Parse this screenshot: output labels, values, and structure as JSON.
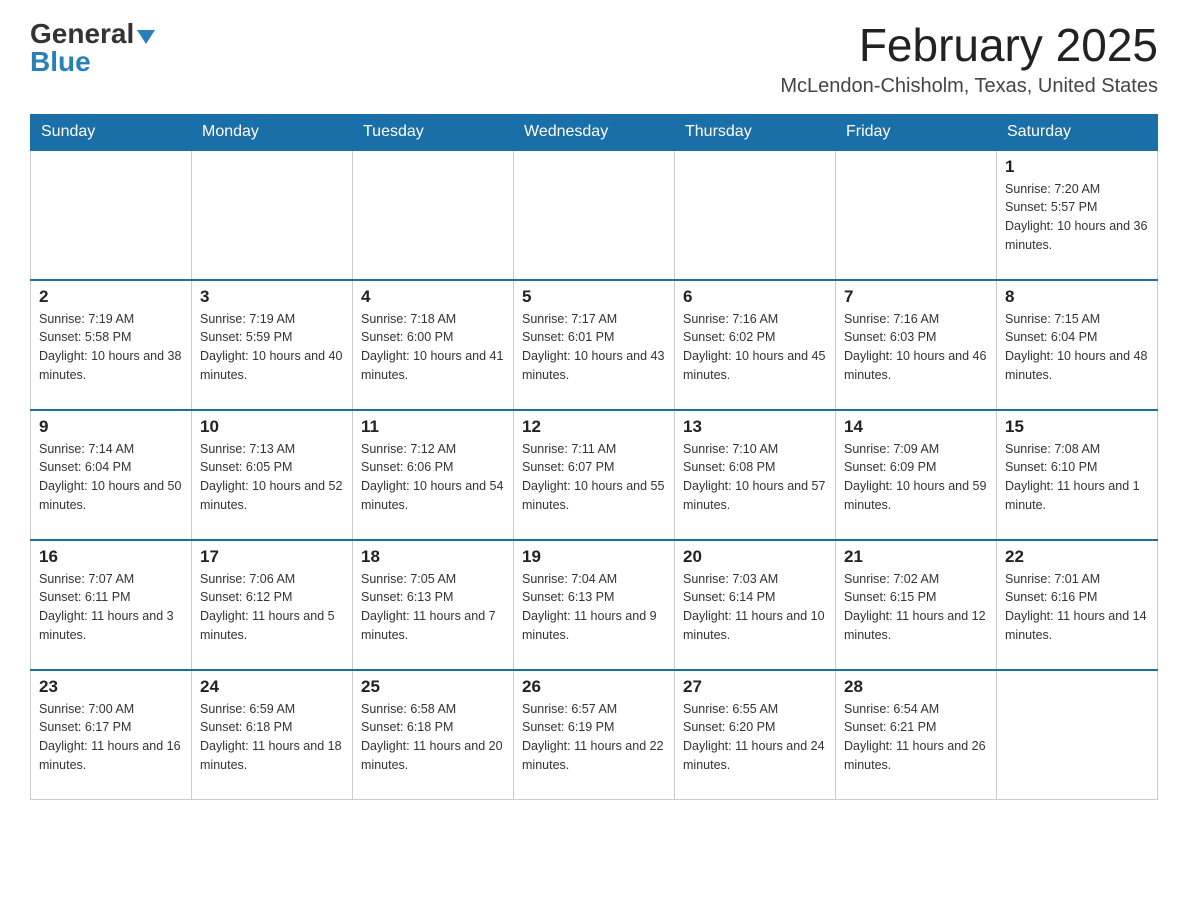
{
  "header": {
    "logo_general": "General",
    "logo_blue": "Blue",
    "month_title": "February 2025",
    "location": "McLendon-Chisholm, Texas, United States"
  },
  "weekdays": [
    "Sunday",
    "Monday",
    "Tuesday",
    "Wednesday",
    "Thursday",
    "Friday",
    "Saturday"
  ],
  "weeks": [
    [
      {
        "day": "",
        "sunrise": "",
        "sunset": "",
        "daylight": ""
      },
      {
        "day": "",
        "sunrise": "",
        "sunset": "",
        "daylight": ""
      },
      {
        "day": "",
        "sunrise": "",
        "sunset": "",
        "daylight": ""
      },
      {
        "day": "",
        "sunrise": "",
        "sunset": "",
        "daylight": ""
      },
      {
        "day": "",
        "sunrise": "",
        "sunset": "",
        "daylight": ""
      },
      {
        "day": "",
        "sunrise": "",
        "sunset": "",
        "daylight": ""
      },
      {
        "day": "1",
        "sunrise": "Sunrise: 7:20 AM",
        "sunset": "Sunset: 5:57 PM",
        "daylight": "Daylight: 10 hours and 36 minutes."
      }
    ],
    [
      {
        "day": "2",
        "sunrise": "Sunrise: 7:19 AM",
        "sunset": "Sunset: 5:58 PM",
        "daylight": "Daylight: 10 hours and 38 minutes."
      },
      {
        "day": "3",
        "sunrise": "Sunrise: 7:19 AM",
        "sunset": "Sunset: 5:59 PM",
        "daylight": "Daylight: 10 hours and 40 minutes."
      },
      {
        "day": "4",
        "sunrise": "Sunrise: 7:18 AM",
        "sunset": "Sunset: 6:00 PM",
        "daylight": "Daylight: 10 hours and 41 minutes."
      },
      {
        "day": "5",
        "sunrise": "Sunrise: 7:17 AM",
        "sunset": "Sunset: 6:01 PM",
        "daylight": "Daylight: 10 hours and 43 minutes."
      },
      {
        "day": "6",
        "sunrise": "Sunrise: 7:16 AM",
        "sunset": "Sunset: 6:02 PM",
        "daylight": "Daylight: 10 hours and 45 minutes."
      },
      {
        "day": "7",
        "sunrise": "Sunrise: 7:16 AM",
        "sunset": "Sunset: 6:03 PM",
        "daylight": "Daylight: 10 hours and 46 minutes."
      },
      {
        "day": "8",
        "sunrise": "Sunrise: 7:15 AM",
        "sunset": "Sunset: 6:04 PM",
        "daylight": "Daylight: 10 hours and 48 minutes."
      }
    ],
    [
      {
        "day": "9",
        "sunrise": "Sunrise: 7:14 AM",
        "sunset": "Sunset: 6:04 PM",
        "daylight": "Daylight: 10 hours and 50 minutes."
      },
      {
        "day": "10",
        "sunrise": "Sunrise: 7:13 AM",
        "sunset": "Sunset: 6:05 PM",
        "daylight": "Daylight: 10 hours and 52 minutes."
      },
      {
        "day": "11",
        "sunrise": "Sunrise: 7:12 AM",
        "sunset": "Sunset: 6:06 PM",
        "daylight": "Daylight: 10 hours and 54 minutes."
      },
      {
        "day": "12",
        "sunrise": "Sunrise: 7:11 AM",
        "sunset": "Sunset: 6:07 PM",
        "daylight": "Daylight: 10 hours and 55 minutes."
      },
      {
        "day": "13",
        "sunrise": "Sunrise: 7:10 AM",
        "sunset": "Sunset: 6:08 PM",
        "daylight": "Daylight: 10 hours and 57 minutes."
      },
      {
        "day": "14",
        "sunrise": "Sunrise: 7:09 AM",
        "sunset": "Sunset: 6:09 PM",
        "daylight": "Daylight: 10 hours and 59 minutes."
      },
      {
        "day": "15",
        "sunrise": "Sunrise: 7:08 AM",
        "sunset": "Sunset: 6:10 PM",
        "daylight": "Daylight: 11 hours and 1 minute."
      }
    ],
    [
      {
        "day": "16",
        "sunrise": "Sunrise: 7:07 AM",
        "sunset": "Sunset: 6:11 PM",
        "daylight": "Daylight: 11 hours and 3 minutes."
      },
      {
        "day": "17",
        "sunrise": "Sunrise: 7:06 AM",
        "sunset": "Sunset: 6:12 PM",
        "daylight": "Daylight: 11 hours and 5 minutes."
      },
      {
        "day": "18",
        "sunrise": "Sunrise: 7:05 AM",
        "sunset": "Sunset: 6:13 PM",
        "daylight": "Daylight: 11 hours and 7 minutes."
      },
      {
        "day": "19",
        "sunrise": "Sunrise: 7:04 AM",
        "sunset": "Sunset: 6:13 PM",
        "daylight": "Daylight: 11 hours and 9 minutes."
      },
      {
        "day": "20",
        "sunrise": "Sunrise: 7:03 AM",
        "sunset": "Sunset: 6:14 PM",
        "daylight": "Daylight: 11 hours and 10 minutes."
      },
      {
        "day": "21",
        "sunrise": "Sunrise: 7:02 AM",
        "sunset": "Sunset: 6:15 PM",
        "daylight": "Daylight: 11 hours and 12 minutes."
      },
      {
        "day": "22",
        "sunrise": "Sunrise: 7:01 AM",
        "sunset": "Sunset: 6:16 PM",
        "daylight": "Daylight: 11 hours and 14 minutes."
      }
    ],
    [
      {
        "day": "23",
        "sunrise": "Sunrise: 7:00 AM",
        "sunset": "Sunset: 6:17 PM",
        "daylight": "Daylight: 11 hours and 16 minutes."
      },
      {
        "day": "24",
        "sunrise": "Sunrise: 6:59 AM",
        "sunset": "Sunset: 6:18 PM",
        "daylight": "Daylight: 11 hours and 18 minutes."
      },
      {
        "day": "25",
        "sunrise": "Sunrise: 6:58 AM",
        "sunset": "Sunset: 6:18 PM",
        "daylight": "Daylight: 11 hours and 20 minutes."
      },
      {
        "day": "26",
        "sunrise": "Sunrise: 6:57 AM",
        "sunset": "Sunset: 6:19 PM",
        "daylight": "Daylight: 11 hours and 22 minutes."
      },
      {
        "day": "27",
        "sunrise": "Sunrise: 6:55 AM",
        "sunset": "Sunset: 6:20 PM",
        "daylight": "Daylight: 11 hours and 24 minutes."
      },
      {
        "day": "28",
        "sunrise": "Sunrise: 6:54 AM",
        "sunset": "Sunset: 6:21 PM",
        "daylight": "Daylight: 11 hours and 26 minutes."
      },
      {
        "day": "",
        "sunrise": "",
        "sunset": "",
        "daylight": ""
      }
    ]
  ]
}
